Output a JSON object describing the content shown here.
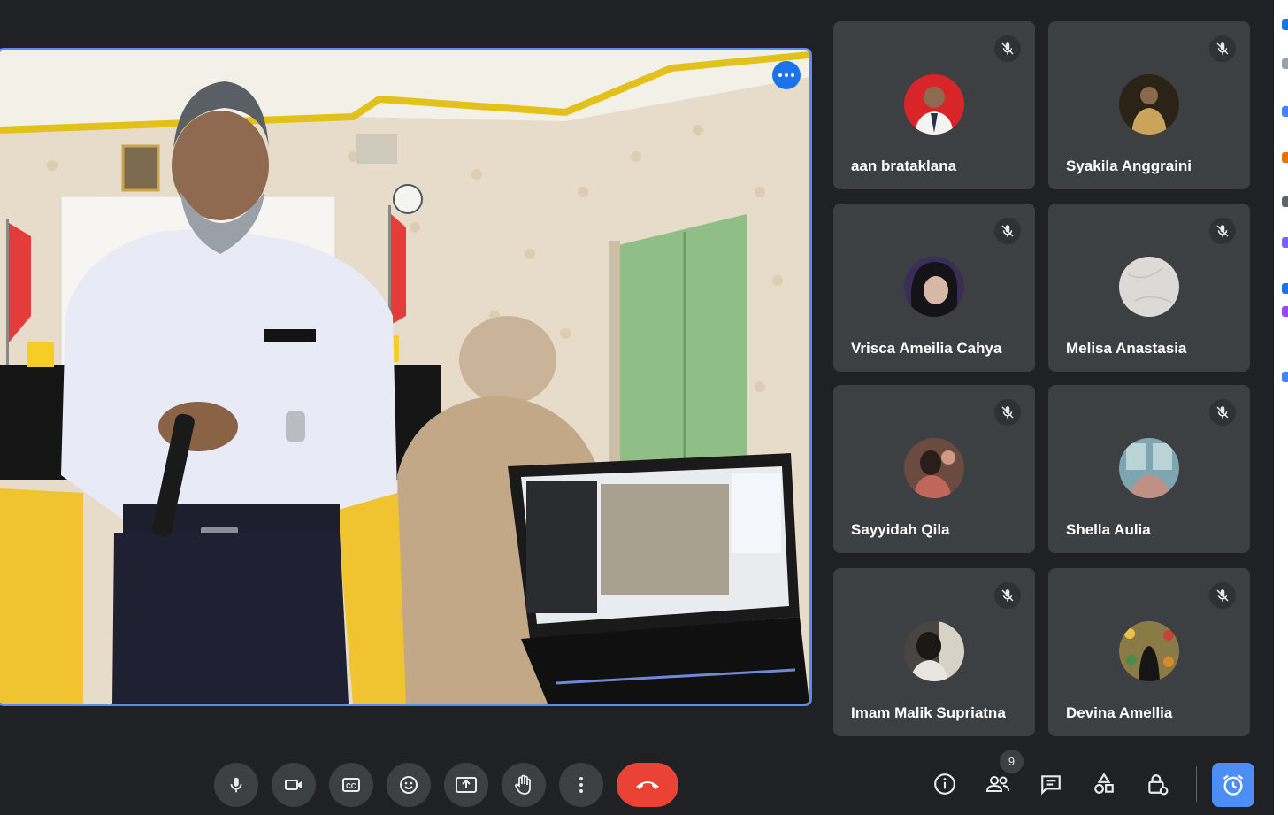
{
  "main_video": {
    "more_options_icon": "more-horizontal-icon",
    "more_options_color": "#1a73e8",
    "border_color": "#5b8df0"
  },
  "participants": [
    {
      "name": "aan brataklana",
      "muted": true,
      "avatar_bg": "#d8252a"
    },
    {
      "name": "Syakila Anggraini",
      "muted": true,
      "avatar_bg": "#2b2416"
    },
    {
      "name": "Vrisca Ameilia Cahya",
      "muted": true,
      "avatar_bg": "#3a2e57"
    },
    {
      "name": "Melisa Anastasia",
      "muted": true,
      "avatar_bg": "#dcdad6"
    },
    {
      "name": "Sayyidah Qila",
      "muted": true,
      "avatar_bg": "#6b4a3f"
    },
    {
      "name": "Shella Aulia",
      "muted": true,
      "avatar_bg": "#7fa6b0"
    },
    {
      "name": "Imam Malik Supriatna",
      "muted": true,
      "avatar_bg": "#4a4540"
    },
    {
      "name": "Devina Amellia",
      "muted": true,
      "avatar_bg": "#8a7a46"
    }
  ],
  "toolbar": {
    "controls": [
      "microphone-icon",
      "camera-icon",
      "captions-icon",
      "emoji-icon",
      "present-screen-icon",
      "raise-hand-icon",
      "more-vertical-icon",
      "end-call-icon"
    ],
    "end_call_color": "#ea4335",
    "right": [
      "info-icon",
      "people-icon",
      "chat-icon",
      "activities-icon",
      "host-controls-icon",
      "timer-icon"
    ],
    "people_count": "9",
    "timer_color": "#4c8df6"
  }
}
